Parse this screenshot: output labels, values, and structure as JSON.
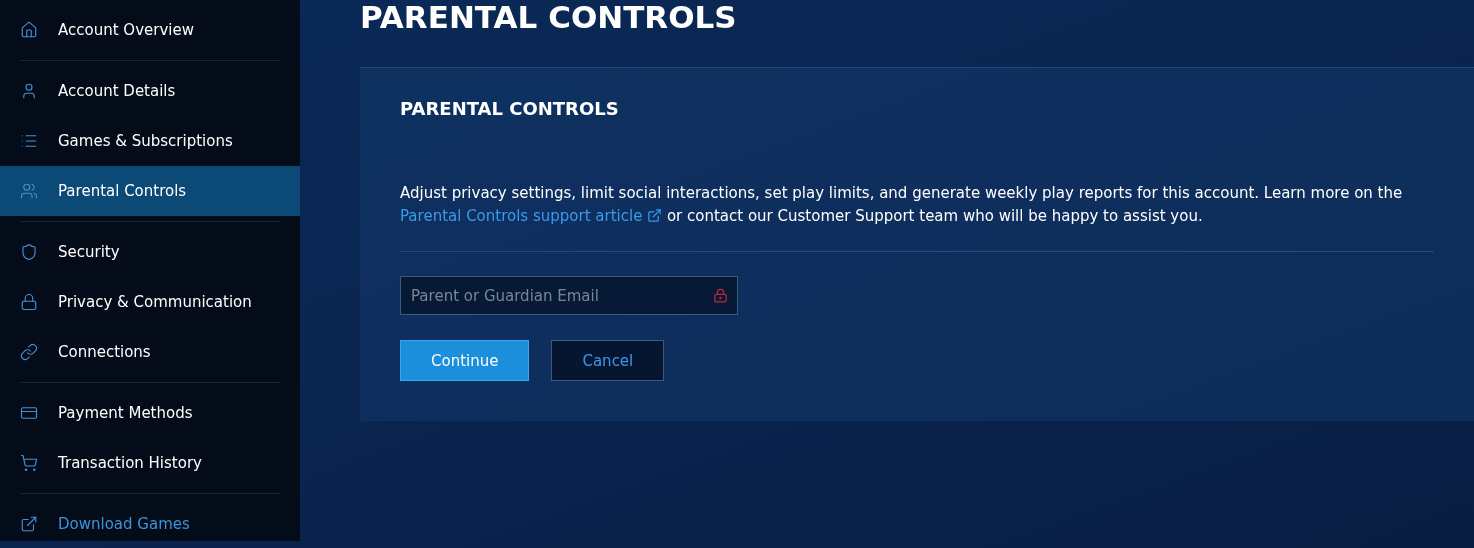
{
  "sidebar": {
    "groups": [
      {
        "items": [
          {
            "label": "Account Overview",
            "selected": false,
            "kind": "page"
          }
        ]
      },
      {
        "items": [
          {
            "label": "Account Details",
            "selected": false,
            "kind": "page"
          },
          {
            "label": "Games & Subscriptions",
            "selected": false,
            "kind": "page"
          },
          {
            "label": "Parental Controls",
            "selected": true,
            "kind": "page"
          }
        ]
      },
      {
        "items": [
          {
            "label": "Security",
            "selected": false,
            "kind": "page"
          },
          {
            "label": "Privacy & Communication",
            "selected": false,
            "kind": "page"
          },
          {
            "label": "Connections",
            "selected": false,
            "kind": "page"
          }
        ]
      },
      {
        "items": [
          {
            "label": "Payment Methods",
            "selected": false,
            "kind": "page"
          },
          {
            "label": "Transaction History",
            "selected": false,
            "kind": "page"
          }
        ]
      },
      {
        "items": [
          {
            "label": "Download Games",
            "selected": false,
            "kind": "link"
          }
        ]
      }
    ]
  },
  "page_title": "PARENTAL CONTROLS",
  "card": {
    "title": "PARENTAL CONTROLS",
    "description": {
      "before": "Adjust privacy settings, limit social interactions, set play limits, and generate weekly play reports for this account. Learn more on the",
      "link": "Parental Controls support article",
      "after": "or contact our Customer Support team who will be happy to assist you."
    },
    "email_field": {
      "placeholder": "Parent or Guardian Email"
    },
    "buttons": [
      {
        "label": "Continue",
        "kind": "primary"
      },
      {
        "label": "Cancel",
        "kind": "secondary"
      }
    ]
  }
}
